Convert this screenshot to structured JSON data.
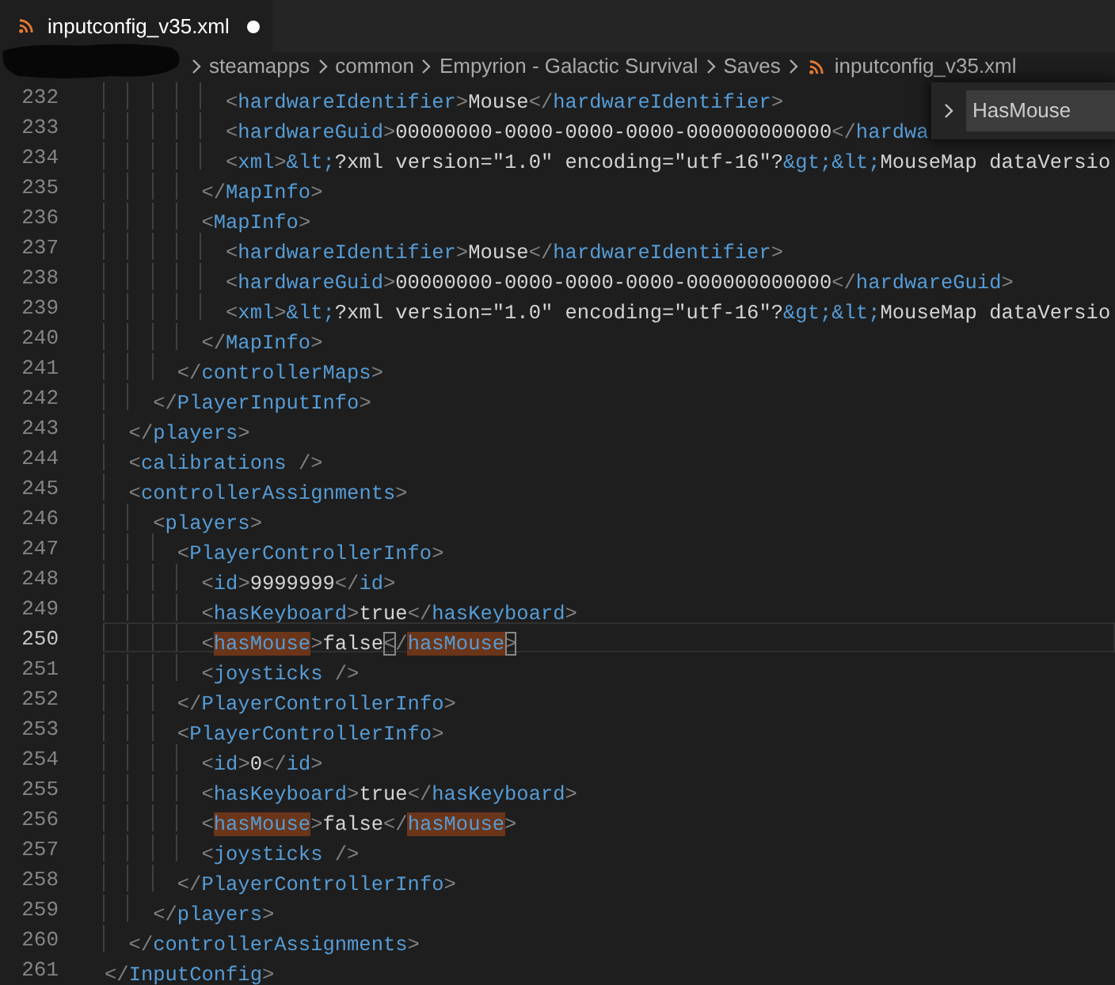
{
  "tab": {
    "title": "inputconfig_v35.xml",
    "modified": true,
    "selected": true
  },
  "breadcrumbs": [
    {
      "label": "steamapps",
      "kind": "folder"
    },
    {
      "label": "common",
      "kind": "folder"
    },
    {
      "label": "Empyrion - Galactic Survival",
      "kind": "folder"
    },
    {
      "label": "Saves",
      "kind": "folder"
    },
    {
      "label": "inputconfig_v35.xml",
      "kind": "file"
    }
  ],
  "find_widget": {
    "value": "HasMouse"
  },
  "lines": [
    {
      "number": "232",
      "current": false,
      "tokens": [
        {
          "kind": "punct",
          "text": "          <"
        },
        {
          "kind": "tag",
          "text": "hardwareIdentifier"
        },
        {
          "kind": "punct",
          "text": ">"
        },
        {
          "kind": "text",
          "text": "Mouse"
        },
        {
          "kind": "punct",
          "text": "</"
        },
        {
          "kind": "tag",
          "text": "hardwareIdentifier"
        },
        {
          "kind": "punct",
          "text": ">"
        }
      ]
    },
    {
      "number": "233",
      "current": false,
      "tokens": [
        {
          "kind": "punct",
          "text": "          <"
        },
        {
          "kind": "tag",
          "text": "hardwareGuid"
        },
        {
          "kind": "punct",
          "text": ">"
        },
        {
          "kind": "text",
          "text": "00000000-0000-0000-0000-000000000000"
        },
        {
          "kind": "punct",
          "text": "</"
        },
        {
          "kind": "tag",
          "text": "hardwa"
        }
      ]
    },
    {
      "number": "234",
      "current": false,
      "tokens": [
        {
          "kind": "punct",
          "text": "          <"
        },
        {
          "kind": "tag",
          "text": "xml"
        },
        {
          "kind": "punct",
          "text": ">"
        },
        {
          "kind": "entity",
          "text": "&lt;"
        },
        {
          "kind": "text",
          "text": "?xml version=\"1.0\" encoding=\"utf-16\"?"
        },
        {
          "kind": "entity",
          "text": "&gt;&lt;"
        },
        {
          "kind": "text",
          "text": "MouseMap dataVersio"
        }
      ]
    },
    {
      "number": "235",
      "current": false,
      "tokens": [
        {
          "kind": "punct",
          "text": "        </"
        },
        {
          "kind": "tag",
          "text": "MapInfo"
        },
        {
          "kind": "punct",
          "text": ">"
        }
      ]
    },
    {
      "number": "236",
      "current": false,
      "tokens": [
        {
          "kind": "punct",
          "text": "        <"
        },
        {
          "kind": "tag",
          "text": "MapInfo"
        },
        {
          "kind": "punct",
          "text": ">"
        }
      ]
    },
    {
      "number": "237",
      "current": false,
      "tokens": [
        {
          "kind": "punct",
          "text": "          <"
        },
        {
          "kind": "tag",
          "text": "hardwareIdentifier"
        },
        {
          "kind": "punct",
          "text": ">"
        },
        {
          "kind": "text",
          "text": "Mouse"
        },
        {
          "kind": "punct",
          "text": "</"
        },
        {
          "kind": "tag",
          "text": "hardwareIdentifier"
        },
        {
          "kind": "punct",
          "text": ">"
        }
      ]
    },
    {
      "number": "238",
      "current": false,
      "tokens": [
        {
          "kind": "punct",
          "text": "          <"
        },
        {
          "kind": "tag",
          "text": "hardwareGuid"
        },
        {
          "kind": "punct",
          "text": ">"
        },
        {
          "kind": "text",
          "text": "00000000-0000-0000-0000-000000000000"
        },
        {
          "kind": "punct",
          "text": "</"
        },
        {
          "kind": "tag",
          "text": "hardwareGuid"
        },
        {
          "kind": "punct",
          "text": ">"
        }
      ]
    },
    {
      "number": "239",
      "current": false,
      "tokens": [
        {
          "kind": "punct",
          "text": "          <"
        },
        {
          "kind": "tag",
          "text": "xml"
        },
        {
          "kind": "punct",
          "text": ">"
        },
        {
          "kind": "entity",
          "text": "&lt;"
        },
        {
          "kind": "text",
          "text": "?xml version=\"1.0\" encoding=\"utf-16\"?"
        },
        {
          "kind": "entity",
          "text": "&gt;&lt;"
        },
        {
          "kind": "text",
          "text": "MouseMap dataVersio"
        }
      ]
    },
    {
      "number": "240",
      "current": false,
      "tokens": [
        {
          "kind": "punct",
          "text": "        </"
        },
        {
          "kind": "tag",
          "text": "MapInfo"
        },
        {
          "kind": "punct",
          "text": ">"
        }
      ]
    },
    {
      "number": "241",
      "current": false,
      "tokens": [
        {
          "kind": "punct",
          "text": "      </"
        },
        {
          "kind": "tag",
          "text": "controllerMaps"
        },
        {
          "kind": "punct",
          "text": ">"
        }
      ]
    },
    {
      "number": "242",
      "current": false,
      "tokens": [
        {
          "kind": "punct",
          "text": "    </"
        },
        {
          "kind": "tag",
          "text": "PlayerInputInfo"
        },
        {
          "kind": "punct",
          "text": ">"
        }
      ]
    },
    {
      "number": "243",
      "current": false,
      "tokens": [
        {
          "kind": "punct",
          "text": "  </"
        },
        {
          "kind": "tag",
          "text": "players"
        },
        {
          "kind": "punct",
          "text": ">"
        }
      ]
    },
    {
      "number": "244",
      "current": false,
      "tokens": [
        {
          "kind": "punct",
          "text": "  <"
        },
        {
          "kind": "tag",
          "text": "calibrations"
        },
        {
          "kind": "punct",
          "text": " />"
        }
      ]
    },
    {
      "number": "245",
      "current": false,
      "tokens": [
        {
          "kind": "punct",
          "text": "  <"
        },
        {
          "kind": "tag",
          "text": "controllerAssignments"
        },
        {
          "kind": "punct",
          "text": ">"
        }
      ]
    },
    {
      "number": "246",
      "current": false,
      "tokens": [
        {
          "kind": "punct",
          "text": "    <"
        },
        {
          "kind": "tag",
          "text": "players"
        },
        {
          "kind": "punct",
          "text": ">"
        }
      ]
    },
    {
      "number": "247",
      "current": false,
      "tokens": [
        {
          "kind": "punct",
          "text": "      <"
        },
        {
          "kind": "tag",
          "text": "PlayerControllerInfo"
        },
        {
          "kind": "punct",
          "text": ">"
        }
      ]
    },
    {
      "number": "248",
      "current": false,
      "tokens": [
        {
          "kind": "punct",
          "text": "        <"
        },
        {
          "kind": "tag",
          "text": "id"
        },
        {
          "kind": "punct",
          "text": ">"
        },
        {
          "kind": "text",
          "text": "9999999"
        },
        {
          "kind": "punct",
          "text": "</"
        },
        {
          "kind": "tag",
          "text": "id"
        },
        {
          "kind": "punct",
          "text": ">"
        }
      ]
    },
    {
      "number": "249",
      "current": false,
      "tokens": [
        {
          "kind": "punct",
          "text": "        <"
        },
        {
          "kind": "tag",
          "text": "hasKeyboard"
        },
        {
          "kind": "punct",
          "text": ">"
        },
        {
          "kind": "text",
          "text": "true"
        },
        {
          "kind": "punct",
          "text": "</"
        },
        {
          "kind": "tag",
          "text": "hasKeyboard"
        },
        {
          "kind": "punct",
          "text": ">"
        }
      ]
    },
    {
      "number": "250",
      "current": true,
      "tokens": [
        {
          "kind": "punct",
          "text": "        <"
        },
        {
          "kind": "tag",
          "text": "hasMouse",
          "match": true
        },
        {
          "kind": "punct",
          "text": ">"
        },
        {
          "kind": "text",
          "text": "false"
        },
        {
          "kind": "punct",
          "text": "<",
          "bracket_match": true
        },
        {
          "kind": "punct",
          "text": "/"
        },
        {
          "kind": "tag",
          "text": "hasMouse",
          "match": true
        },
        {
          "kind": "punct",
          "text": ">",
          "bracket_match": true
        }
      ]
    },
    {
      "number": "251",
      "current": false,
      "tokens": [
        {
          "kind": "punct",
          "text": "        <"
        },
        {
          "kind": "tag",
          "text": "joysticks"
        },
        {
          "kind": "punct",
          "text": " />"
        }
      ]
    },
    {
      "number": "252",
      "current": false,
      "tokens": [
        {
          "kind": "punct",
          "text": "      </"
        },
        {
          "kind": "tag",
          "text": "PlayerControllerInfo"
        },
        {
          "kind": "punct",
          "text": ">"
        }
      ]
    },
    {
      "number": "253",
      "current": false,
      "tokens": [
        {
          "kind": "punct",
          "text": "      <"
        },
        {
          "kind": "tag",
          "text": "PlayerControllerInfo"
        },
        {
          "kind": "punct",
          "text": ">"
        }
      ]
    },
    {
      "number": "254",
      "current": false,
      "tokens": [
        {
          "kind": "punct",
          "text": "        <"
        },
        {
          "kind": "tag",
          "text": "id"
        },
        {
          "kind": "punct",
          "text": ">"
        },
        {
          "kind": "text",
          "text": "0"
        },
        {
          "kind": "punct",
          "text": "</"
        },
        {
          "kind": "tag",
          "text": "id"
        },
        {
          "kind": "punct",
          "text": ">"
        }
      ]
    },
    {
      "number": "255",
      "current": false,
      "tokens": [
        {
          "kind": "punct",
          "text": "        <"
        },
        {
          "kind": "tag",
          "text": "hasKeyboard"
        },
        {
          "kind": "punct",
          "text": ">"
        },
        {
          "kind": "text",
          "text": "true"
        },
        {
          "kind": "punct",
          "text": "</"
        },
        {
          "kind": "tag",
          "text": "hasKeyboard"
        },
        {
          "kind": "punct",
          "text": ">"
        }
      ]
    },
    {
      "number": "256",
      "current": false,
      "tokens": [
        {
          "kind": "punct",
          "text": "        <"
        },
        {
          "kind": "tag",
          "text": "hasMouse",
          "match": true
        },
        {
          "kind": "punct",
          "text": ">"
        },
        {
          "kind": "text",
          "text": "false"
        },
        {
          "kind": "punct",
          "text": "</"
        },
        {
          "kind": "tag",
          "text": "hasMouse",
          "match": true
        },
        {
          "kind": "punct",
          "text": ">"
        }
      ]
    },
    {
      "number": "257",
      "current": false,
      "tokens": [
        {
          "kind": "punct",
          "text": "        <"
        },
        {
          "kind": "tag",
          "text": "joysticks"
        },
        {
          "kind": "punct",
          "text": " />"
        }
      ]
    },
    {
      "number": "258",
      "current": false,
      "tokens": [
        {
          "kind": "punct",
          "text": "      </"
        },
        {
          "kind": "tag",
          "text": "PlayerControllerInfo"
        },
        {
          "kind": "punct",
          "text": ">"
        }
      ]
    },
    {
      "number": "259",
      "current": false,
      "tokens": [
        {
          "kind": "punct",
          "text": "    </"
        },
        {
          "kind": "tag",
          "text": "players"
        },
        {
          "kind": "punct",
          "text": ">"
        }
      ]
    },
    {
      "number": "260",
      "current": false,
      "tokens": [
        {
          "kind": "punct",
          "text": "  </"
        },
        {
          "kind": "tag",
          "text": "controllerAssignments"
        },
        {
          "kind": "punct",
          "text": ">"
        }
      ]
    },
    {
      "number": "261",
      "current": false,
      "tokens": [
        {
          "kind": "punct",
          "text": "</"
        },
        {
          "kind": "tag",
          "text": "InputConfig"
        },
        {
          "kind": "punct",
          "text": ">"
        }
      ]
    }
  ]
}
